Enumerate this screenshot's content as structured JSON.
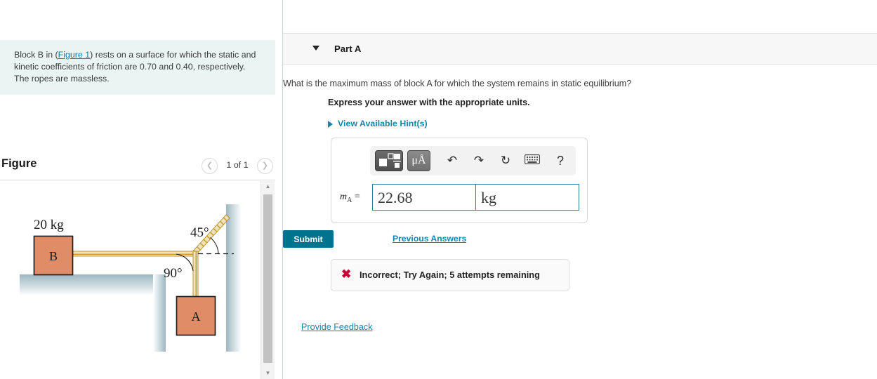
{
  "left": {
    "problem": {
      "text_before_link": "Block B in (",
      "link_text": "Figure 1",
      "text_after_link": ") rests on a surface for which the static and kinetic coefficients of friction are 0.70 and 0.40, respectively. The ropes are massless."
    },
    "figure": {
      "title": "Figure",
      "prev_icon": "chevron-left",
      "next_icon": "chevron-right",
      "counter": "1 of 1",
      "labels": {
        "mass_b": "20 kg",
        "block_b": "B",
        "block_a": "A",
        "angle_upper": "45°",
        "angle_lower": "90°"
      },
      "colors": {
        "block_fill": "#e08c67",
        "block_stroke": "#231f20",
        "rope_fill": "#efe3bc",
        "rope_stroke": "#c9972c",
        "surface": "#b9ccd3"
      }
    },
    "scrollbar": {
      "up_icon": "triangle-up",
      "down_icon": "triangle-down"
    }
  },
  "right": {
    "part": {
      "caret_icon": "caret-down",
      "title": "Part A"
    },
    "question": "What is the maximum mass of block A for which the system remains in static equilibrium?",
    "instruction": "Express your answer with the appropriate units.",
    "hints": {
      "caret_icon": "caret-right",
      "label": "View Available Hint(s)"
    },
    "answer": {
      "toolbar": {
        "template_icon": "math-template-icon",
        "units_label": "μÅ",
        "undo_icon": "↶",
        "redo_icon": "↷",
        "reset_icon": "↻",
        "keyboard_icon": "⌨",
        "help_icon": "?"
      },
      "prefix": "m",
      "prefix_sub": "A",
      "prefix_eq": " =",
      "value": "22.68",
      "units": "kg"
    },
    "submit_label": "Submit",
    "previous_answers_label": "Previous Answers",
    "feedback": {
      "icon": "✖",
      "message": "Incorrect; Try Again; 5 attempts remaining"
    },
    "provide_feedback_label": "Provide Feedback",
    "colors": {
      "submit_bg": "#00748f",
      "link": "#1686a8",
      "error": "#cc0033",
      "field_border": "#2e7f92"
    }
  }
}
